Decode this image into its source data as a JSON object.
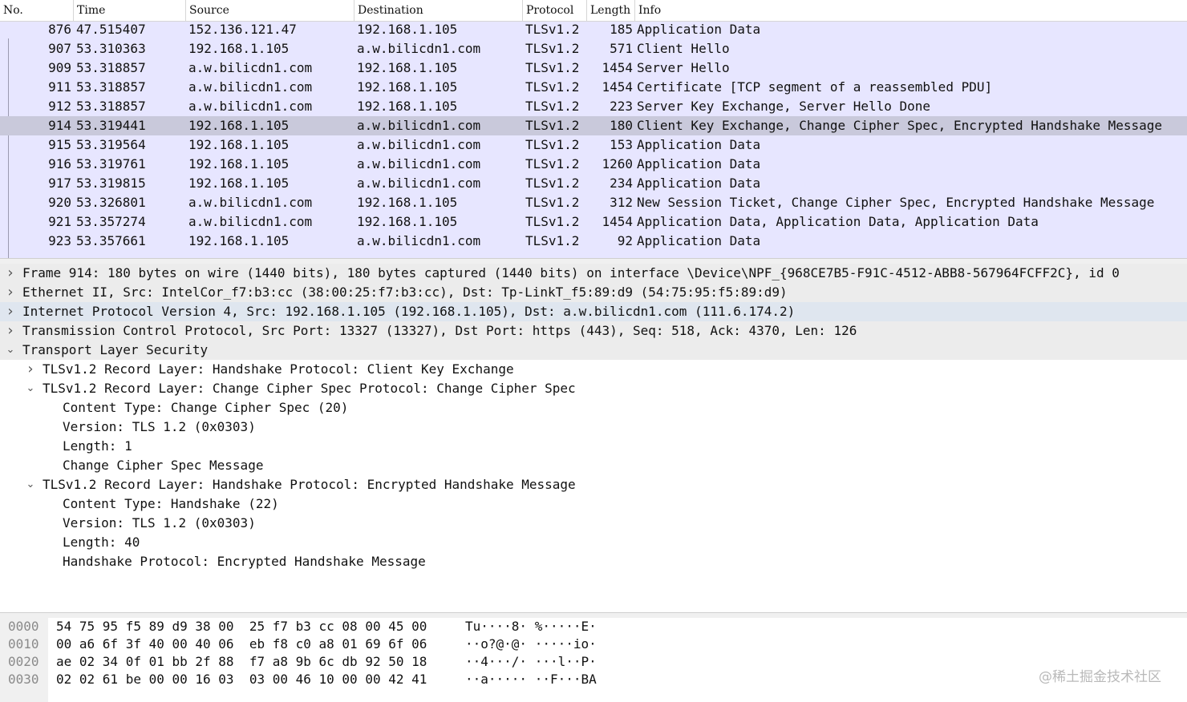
{
  "columns": {
    "no": "No.",
    "time": "Time",
    "source": "Source",
    "destination": "Destination",
    "protocol": "Protocol",
    "length": "Length",
    "info": "Info"
  },
  "packets": [
    {
      "no": "876",
      "time": "47.515407",
      "src": "152.136.121.47",
      "dst": "192.168.1.105",
      "proto": "TLSv1.2",
      "len": "185",
      "info": "Application Data"
    },
    {
      "no": "907",
      "time": "53.310363",
      "src": "192.168.1.105",
      "dst": "a.w.bilicdn1.com",
      "proto": "TLSv1.2",
      "len": "571",
      "info": "Client Hello"
    },
    {
      "no": "909",
      "time": "53.318857",
      "src": "a.w.bilicdn1.com",
      "dst": "192.168.1.105",
      "proto": "TLSv1.2",
      "len": "1454",
      "info": "Server Hello"
    },
    {
      "no": "911",
      "time": "53.318857",
      "src": "a.w.bilicdn1.com",
      "dst": "192.168.1.105",
      "proto": "TLSv1.2",
      "len": "1454",
      "info": "Certificate [TCP segment of a reassembled PDU]"
    },
    {
      "no": "912",
      "time": "53.318857",
      "src": "a.w.bilicdn1.com",
      "dst": "192.168.1.105",
      "proto": "TLSv1.2",
      "len": "223",
      "info": "Server Key Exchange, Server Hello Done"
    },
    {
      "no": "914",
      "time": "53.319441",
      "src": "192.168.1.105",
      "dst": "a.w.bilicdn1.com",
      "proto": "TLSv1.2",
      "len": "180",
      "info": "Client Key Exchange, Change Cipher Spec, Encrypted Handshake Message"
    },
    {
      "no": "915",
      "time": "53.319564",
      "src": "192.168.1.105",
      "dst": "a.w.bilicdn1.com",
      "proto": "TLSv1.2",
      "len": "153",
      "info": "Application Data"
    },
    {
      "no": "916",
      "time": "53.319761",
      "src": "192.168.1.105",
      "dst": "a.w.bilicdn1.com",
      "proto": "TLSv1.2",
      "len": "1260",
      "info": "Application Data"
    },
    {
      "no": "917",
      "time": "53.319815",
      "src": "192.168.1.105",
      "dst": "a.w.bilicdn1.com",
      "proto": "TLSv1.2",
      "len": "234",
      "info": "Application Data"
    },
    {
      "no": "920",
      "time": "53.326801",
      "src": "a.w.bilicdn1.com",
      "dst": "192.168.1.105",
      "proto": "TLSv1.2",
      "len": "312",
      "info": "New Session Ticket, Change Cipher Spec, Encrypted Handshake Message"
    },
    {
      "no": "921",
      "time": "53.357274",
      "src": "a.w.bilicdn1.com",
      "dst": "192.168.1.105",
      "proto": "TLSv1.2",
      "len": "1454",
      "info": "Application Data, Application Data, Application Data"
    },
    {
      "no": "923",
      "time": "53.357661",
      "src": "192.168.1.105",
      "dst": "a.w.bilicdn1.com",
      "proto": "TLSv1.2",
      "len": "92",
      "info": "Application Data"
    }
  ],
  "selected_packet": "914",
  "details": [
    {
      "text": "Frame 914: 180 bytes on wire (1440 bits), 180 bytes captured (1440 bits) on interface \\Device\\NPF_{968CE7B5-F91C-4512-ABB8-567964FCFF2C}, id 0",
      "expander": "collapsed"
    },
    {
      "text": "Ethernet II, Src: IntelCor_f7:b3:cc (38:00:25:f7:b3:cc), Dst: Tp-LinkT_f5:89:d9 (54:75:95:f5:89:d9)",
      "expander": "collapsed"
    },
    {
      "text": "Internet Protocol Version 4, Src: 192.168.1.105 (192.168.1.105), Dst: a.w.bilicdn1.com (111.6.174.2)",
      "expander": "collapsed"
    },
    {
      "text": "Transmission Control Protocol, Src Port: 13327 (13327), Dst Port: https (443), Seq: 518, Ack: 4370, Len: 126",
      "expander": "collapsed"
    },
    {
      "text": "Transport Layer Security",
      "expander": "expanded"
    },
    {
      "text": "TLSv1.2 Record Layer: Handshake Protocol: Client Key Exchange",
      "expander": "collapsed"
    },
    {
      "text": "TLSv1.2 Record Layer: Change Cipher Spec Protocol: Change Cipher Spec",
      "expander": "expanded"
    },
    {
      "text": "Content Type: Change Cipher Spec (20)",
      "expander": "none"
    },
    {
      "text": "Version: TLS 1.2 (0x0303)",
      "expander": "none"
    },
    {
      "text": "Length: 1",
      "expander": "none"
    },
    {
      "text": "Change Cipher Spec Message",
      "expander": "none"
    },
    {
      "text": "TLSv1.2 Record Layer: Handshake Protocol: Encrypted Handshake Message",
      "expander": "expanded"
    },
    {
      "text": "Content Type: Handshake (22)",
      "expander": "none"
    },
    {
      "text": "Version: TLS 1.2 (0x0303)",
      "expander": "none"
    },
    {
      "text": "Length: 40",
      "expander": "none"
    },
    {
      "text": "Handshake Protocol: Encrypted Handshake Message",
      "expander": "none"
    }
  ],
  "bytes": [
    {
      "offset": "0000",
      "hex": "54 75 95 f5 89 d9 38 00  25 f7 b3 cc 08 00 45 00",
      "ascii": "Tu····8· %·····E·"
    },
    {
      "offset": "0010",
      "hex": "00 a6 6f 3f 40 00 40 06  eb f8 c0 a8 01 69 6f 06",
      "ascii": "··o?@·@· ·····io·"
    },
    {
      "offset": "0020",
      "hex": "ae 02 34 0f 01 bb 2f 88  f7 a8 9b 6c db 92 50 18",
      "ascii": "··4···/· ···l··P·"
    },
    {
      "offset": "0030",
      "hex": "02 02 61 be 00 00 16 03  03 00 46 10 00 00 42 41",
      "ascii": "··a····· ··F···BA"
    }
  ],
  "watermark": "@稀土掘金技术社区",
  "icons": {
    "collapsed": "chevron-right-icon",
    "expanded": "chevron-down-icon"
  },
  "colors": {
    "list_bg": "#e7e6ff",
    "selected_row": "#c9c9db",
    "hl_row": "#dfe6ef"
  }
}
